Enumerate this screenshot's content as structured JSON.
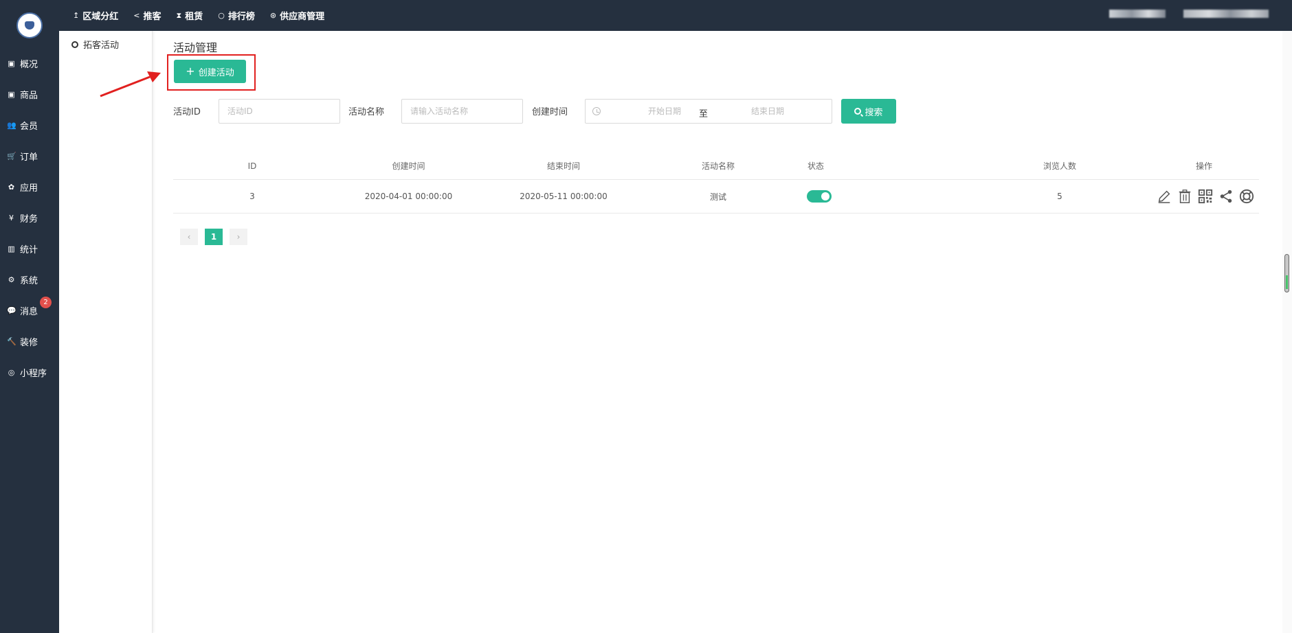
{
  "topnav": [
    {
      "icon": "↥",
      "icon_name": "thumbtack-icon",
      "label": "区域分红"
    },
    {
      "icon": "<",
      "icon_name": "share-icon",
      "label": "推客"
    },
    {
      "icon": "⧗",
      "icon_name": "hourglass-icon",
      "label": "租赁"
    },
    {
      "icon": "○",
      "icon_name": "circle-icon",
      "label": "排行榜"
    },
    {
      "icon": "⊛",
      "icon_name": "skype-icon",
      "label": "供应商管理"
    }
  ],
  "sidebar": {
    "items": [
      {
        "icon": "▣",
        "icon_name": "overview-icon",
        "label": "概况"
      },
      {
        "icon": "▣",
        "icon_name": "product-icon",
        "label": "商品"
      },
      {
        "icon": "👥",
        "icon_name": "members-icon",
        "label": "会员"
      },
      {
        "icon": "🛒",
        "icon_name": "cart-icon",
        "label": "订单"
      },
      {
        "icon": "✿",
        "icon_name": "apps-icon",
        "label": "应用"
      },
      {
        "icon": "¥",
        "icon_name": "yen-icon",
        "label": "财务"
      },
      {
        "icon": "▥",
        "icon_name": "bar-chart-icon",
        "label": "统计"
      },
      {
        "icon": "⚙",
        "icon_name": "cogs-icon",
        "label": "系统"
      },
      {
        "icon": "💬",
        "icon_name": "message-icon",
        "label": "消息"
      },
      {
        "icon": "🔨",
        "icon_name": "gavel-icon",
        "label": "装修"
      },
      {
        "icon": "◎",
        "icon_name": "wechat-icon",
        "label": "小程序"
      }
    ],
    "message_badge": "2"
  },
  "submenu": {
    "item": "拓客活动"
  },
  "page": {
    "title": "活动管理",
    "create_button": "创建活动"
  },
  "filters": {
    "id_label": "活动ID",
    "id_placeholder": "活动ID",
    "name_label": "活动名称",
    "name_placeholder": "请输入活动名称",
    "time_label": "创建时间",
    "start_placeholder": "开始日期",
    "separator": "至",
    "end_placeholder": "结束日期",
    "search_button": "搜索"
  },
  "table": {
    "headers": {
      "id": "ID",
      "created": "创建时间",
      "ended": "结束时间",
      "name": "活动名称",
      "status": "状态",
      "views": "浏览人数",
      "ops": "操作"
    },
    "rows": [
      {
        "id": "3",
        "created": "2020-04-01 00:00:00",
        "ended": "2020-05-11 00:00:00",
        "name": "测试",
        "status_on": true,
        "views": "5"
      }
    ],
    "row_actions": [
      "edit-icon",
      "delete-icon",
      "qrcode-icon",
      "share-icon",
      "lifebuoy-icon"
    ]
  },
  "pagination": {
    "prev": "‹",
    "current": "1",
    "next": "›"
  },
  "colors": {
    "sidebar_bg": "#25303f",
    "accent": "#2ab995",
    "highlight": "#e1201f",
    "badge": "#e2504c"
  }
}
